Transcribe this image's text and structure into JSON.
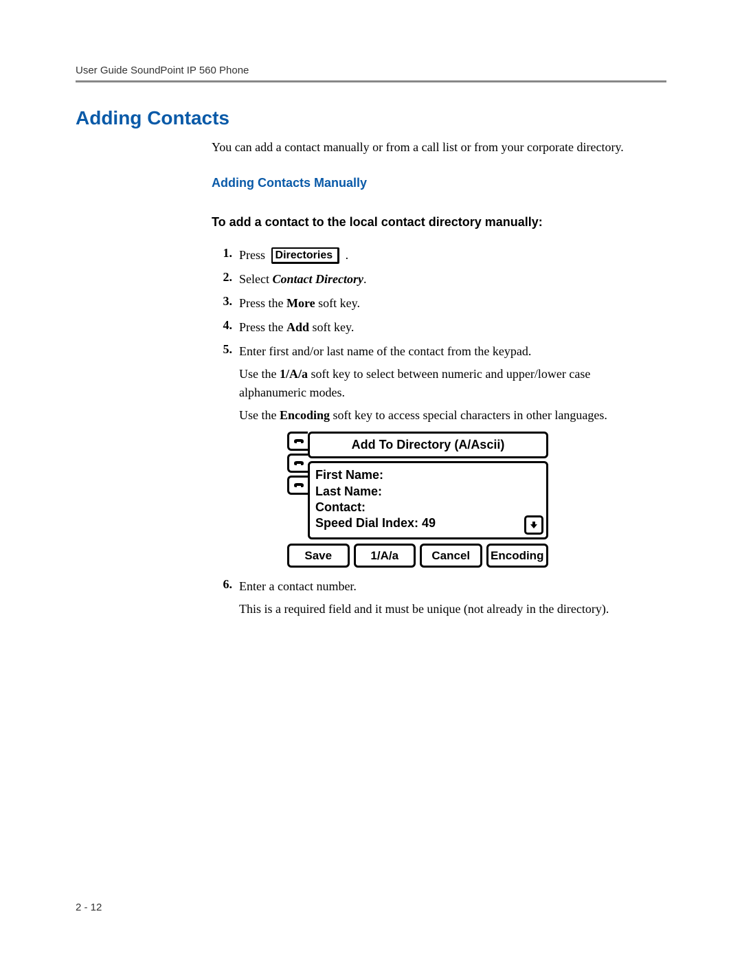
{
  "header": {
    "running": "User Guide SoundPoint IP 560 Phone"
  },
  "section": {
    "title": "Adding Contacts",
    "intro": "You can add a contact manually or from a call list or from your corporate directory.",
    "sub_title": "Adding Contacts Manually",
    "task_title": "To add a contact to the local contact directory manually:"
  },
  "steps": {
    "s1": {
      "num": "1.",
      "pre": "Press ",
      "btn": "Directories",
      "post": " ."
    },
    "s2": {
      "num": "2.",
      "pre": "Select ",
      "em": "Contact Directory",
      "post": "."
    },
    "s3": {
      "num": "3.",
      "pre": "Press the ",
      "bold": "More",
      "post": " soft key."
    },
    "s4": {
      "num": "4.",
      "pre": "Press the ",
      "bold": "Add",
      "post": " soft key."
    },
    "s5": {
      "num": "5.",
      "line1": "Enter first and/or last name of the contact from the keypad.",
      "line2_pre": "Use the ",
      "line2_bold": "1/A/a",
      "line2_post": " soft key to select between numeric and upper/lower case alphanumeric modes.",
      "line3_pre": "Use the ",
      "line3_bold": "Encoding",
      "line3_post": " soft key to access special characters in other languages."
    },
    "s6": {
      "num": "6.",
      "line1": "Enter a contact number.",
      "line2": "This is a required field and it must be unique (not already in the directory)."
    }
  },
  "phone": {
    "title": "Add To Directory (A/Ascii)",
    "fields": {
      "first": "First Name:",
      "last": "Last Name:",
      "contact": "Contact:",
      "sdi_label": "Speed Dial Index: ",
      "sdi_value": "49"
    },
    "softkeys": {
      "k1": "Save",
      "k2": "1/A/a",
      "k3": "Cancel",
      "k4": "Encoding"
    }
  },
  "footer": {
    "page": "2 - 12"
  }
}
